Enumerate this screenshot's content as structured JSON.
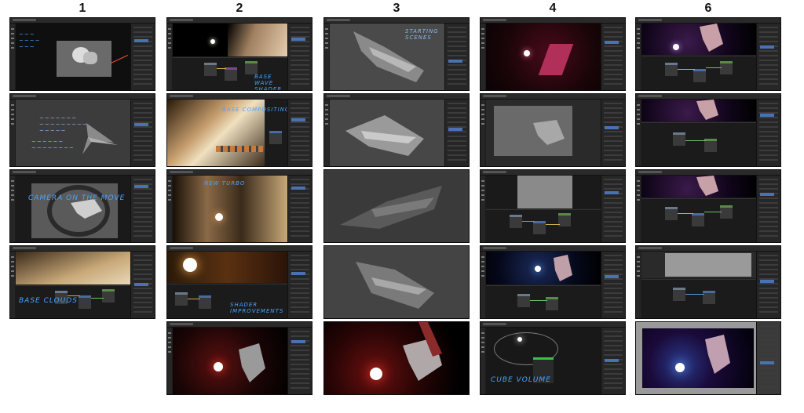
{
  "columns": [
    {
      "number": "1"
    },
    {
      "number": "2"
    },
    {
      "number": "3"
    },
    {
      "number": "4"
    },
    {
      "number": "6"
    }
  ],
  "annotations": {
    "c1p3": "CAMERA ON THE MOVE",
    "c1p4": "BASE CLOUDS",
    "c2p1": "BASE WAVE SHADER",
    "c2p2": "BASE COMPOSITING",
    "c2p3": "NEW TURBO",
    "c2p4": "SHADER IMPROVEMENTS",
    "c3p1": "STARTING SCENES",
    "c4p5": "CUBE VOLUME"
  },
  "colors": {
    "ui_bg": "#1d1d1d",
    "panel_bg": "#262626",
    "accent_blue": "#4a72b0",
    "note_blue": "#4aa3ff",
    "note_red": "#ff5a3a",
    "star_white": "#ffffff",
    "star_red": "#ff3a2a"
  },
  "icons": [
    "menu-icon",
    "tool-icon",
    "node-icon"
  ]
}
